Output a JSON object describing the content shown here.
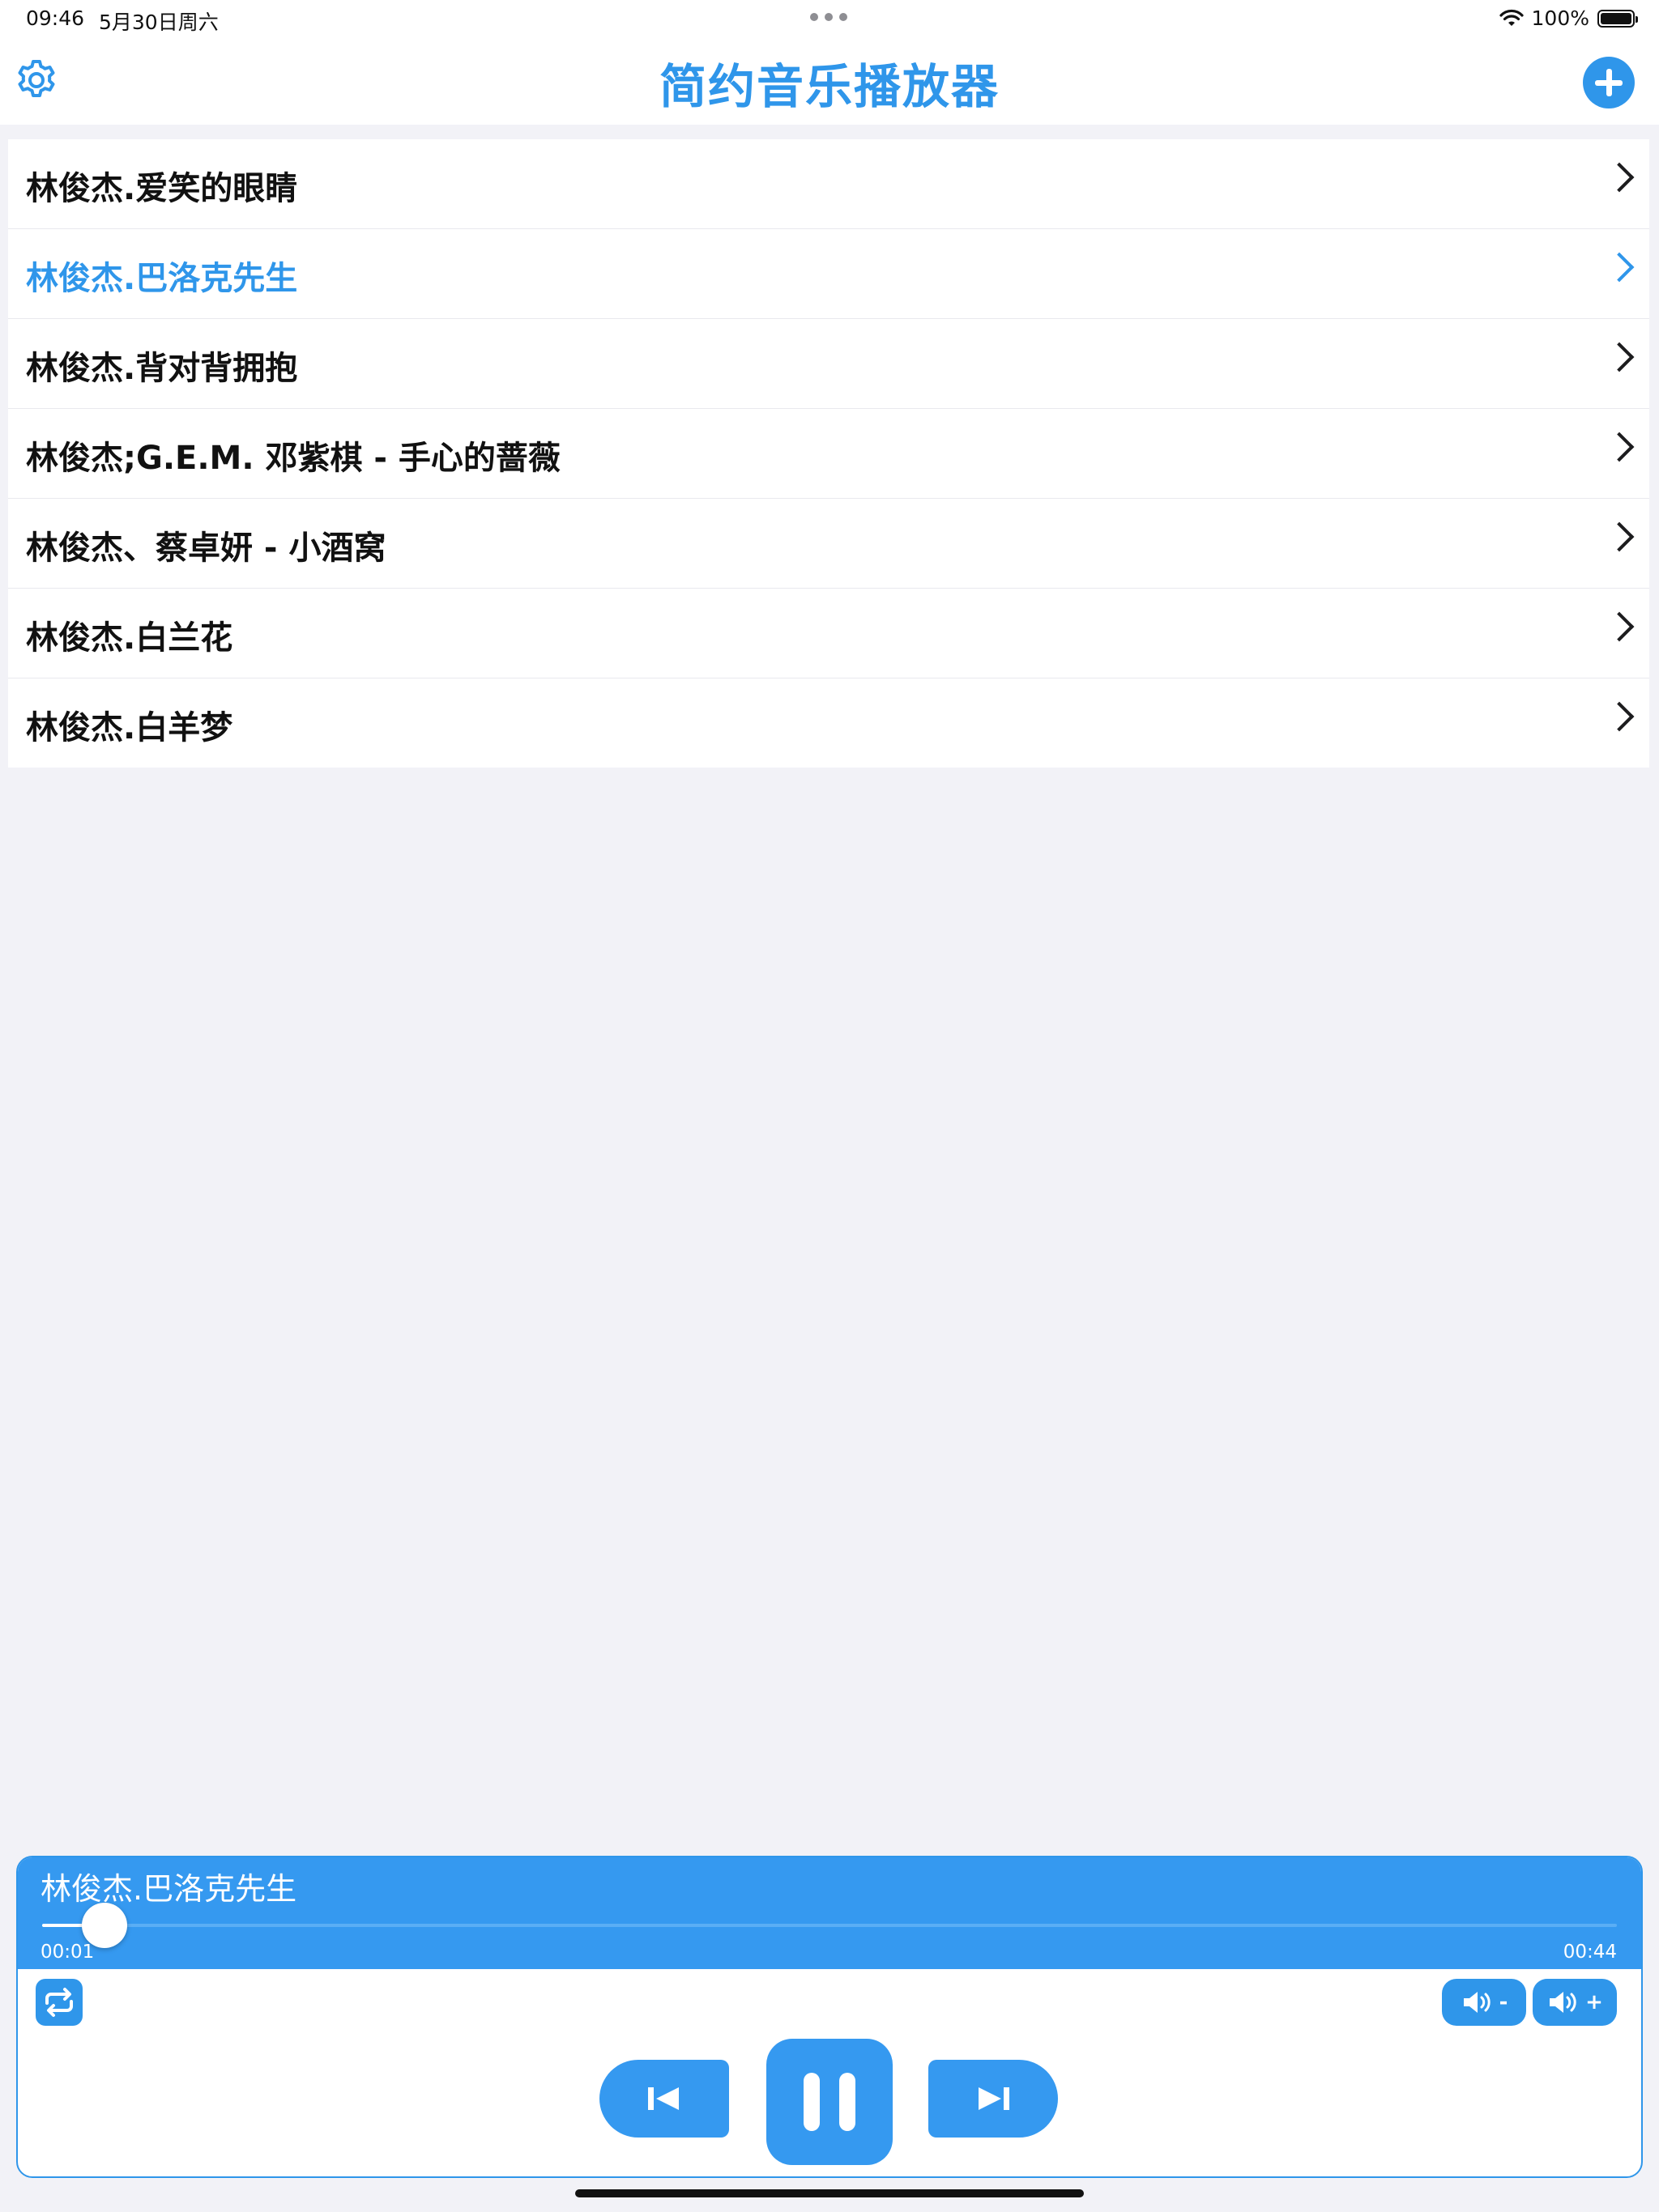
{
  "status_bar": {
    "time": "09:46",
    "date": "5月30日周六",
    "battery": "100%"
  },
  "nav": {
    "title": "简约音乐播放器",
    "left_icon": "gear-icon",
    "right_icon": "plus-circle-icon"
  },
  "songs": [
    {
      "title": "林俊杰.爱笑的眼睛"
    },
    {
      "title": "林俊杰.巴洛克先生"
    },
    {
      "title": "林俊杰.背对背拥抱"
    },
    {
      "title": "林俊杰;G.E.M. 邓紫棋 - 手心的蔷薇"
    },
    {
      "title": "林俊杰、蔡卓妍 - 小酒窝"
    },
    {
      "title": "林俊杰.白兰花"
    },
    {
      "title": "林俊杰.白羊梦"
    }
  ],
  "active_song_index": 1,
  "player": {
    "now_playing": "林俊杰.巴洛克先生",
    "current_time": "00:01",
    "total_time": "00:44",
    "progress": 0.023,
    "vol_down_sign": "-",
    "vol_up_sign": "+"
  },
  "colors": {
    "accent": "#2f96ea",
    "player_bar": "#3599f0",
    "background": "#f2f2f7"
  }
}
